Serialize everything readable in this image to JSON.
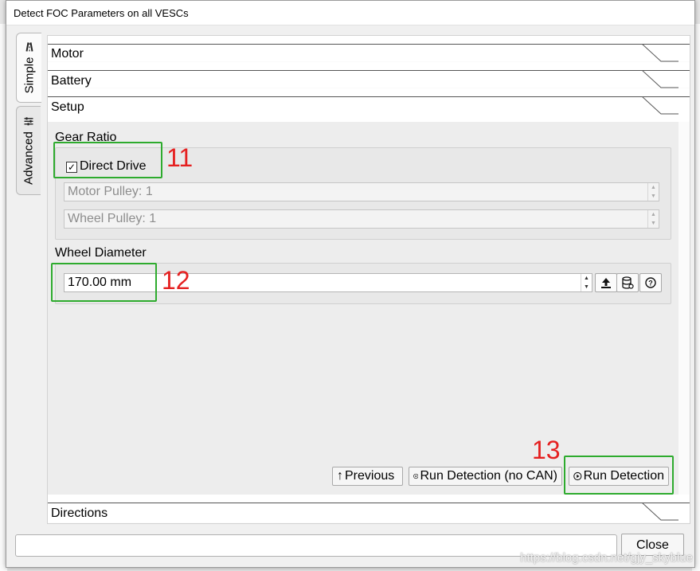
{
  "window": {
    "title": "Detect FOC Parameters on all VESCs"
  },
  "side_tabs": [
    {
      "label": "Simple",
      "icon": "road-icon"
    },
    {
      "label": "Advanced",
      "icon": "sliders-icon"
    }
  ],
  "sections": {
    "motor": "Motor",
    "battery": "Battery",
    "setup": "Setup",
    "directions": "Directions"
  },
  "setup": {
    "gear_ratio_title": "Gear Ratio",
    "direct_drive_label": "Direct Drive",
    "direct_drive_checked": true,
    "motor_pulley": "Motor Pulley: 1",
    "wheel_pulley": "Wheel Pulley: 1",
    "wheel_diameter_title": "Wheel Diameter",
    "wheel_diameter_value": "170.00 mm",
    "tool_icons": [
      "upload-icon",
      "database-icon",
      "help-icon"
    ]
  },
  "buttons": {
    "previous": "Previous",
    "run_detection_no_can": "Run Detection (no CAN)",
    "run_detection": "Run Detection",
    "close": "Close"
  },
  "annotations": {
    "a11": "11",
    "a12": "12",
    "a13": "13"
  },
  "watermark": "https://blog.csdn.net/gjy_skyblue",
  "colors": {
    "highlight": "#2eab2e",
    "annotation": "#e52020"
  }
}
